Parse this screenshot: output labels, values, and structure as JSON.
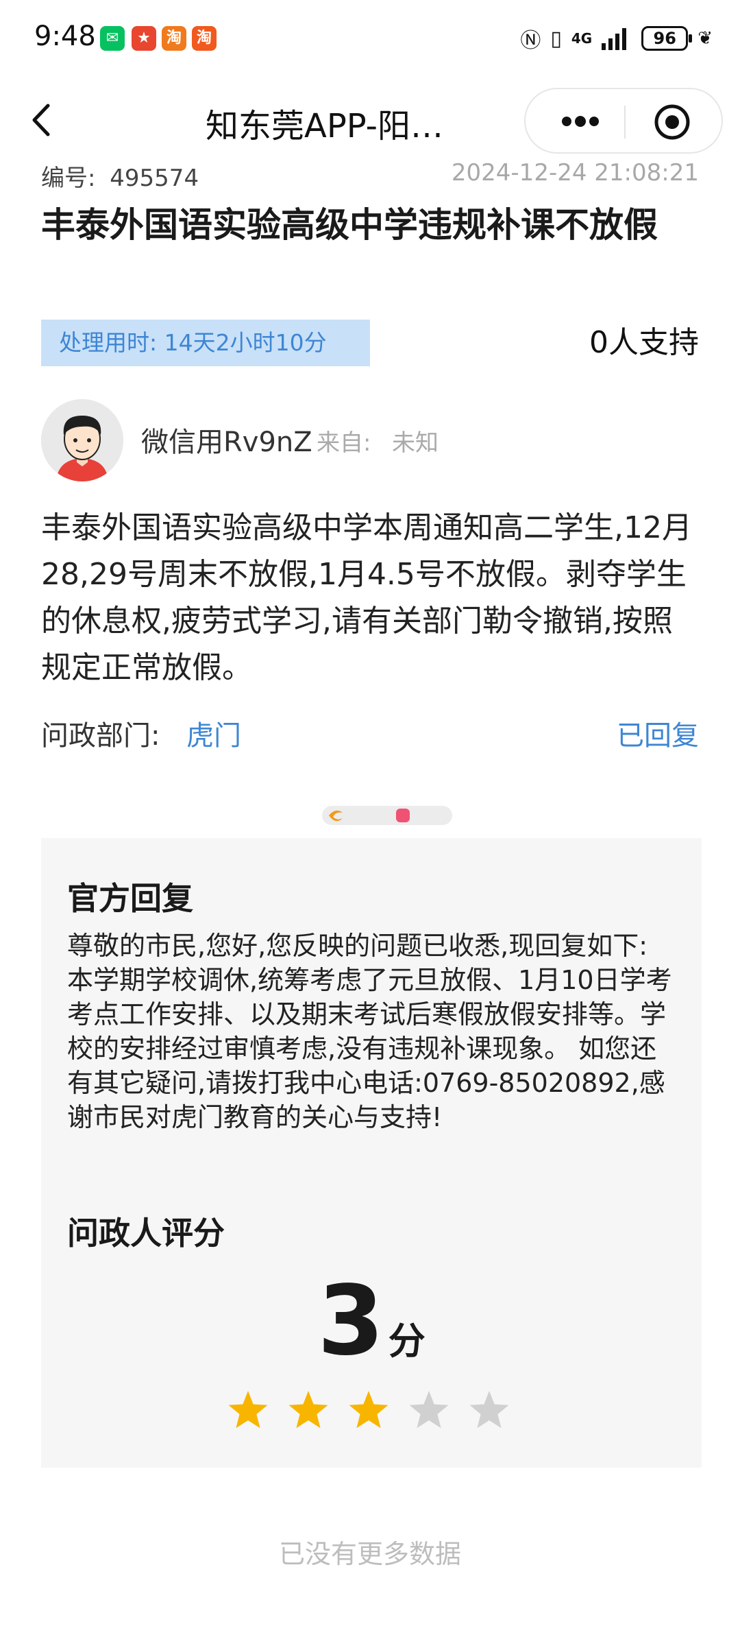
{
  "status_bar": {
    "time": "9:48",
    "network": "4G",
    "battery": "96"
  },
  "nav": {
    "title": "知东莞APP-阳…"
  },
  "post": {
    "id_label": "编号:",
    "id": "495574",
    "datetime": "2024-12-24 21:08:21",
    "title": "丰泰外国语实验高级中学违规补课不放假",
    "duration": "处理用时:  14天2小时10分",
    "support": "0人支持",
    "user": "微信用Rv9nZ",
    "from_label": "来自:",
    "from_value": "未知",
    "body": "丰泰外国语实验高级中学本周通知高二学生,12月28,29号周末不放假,1月4.5号不放假。剥夺学生的休息权,疲劳式学习,请有关部门勒令撤销,按照规定正常放假。",
    "dept_label": "问政部门:",
    "dept": "虎门",
    "status": "已回复"
  },
  "reply": {
    "title": "官方回复",
    "body": "尊敬的市民,您好,您反映的问题已收悉,现回复如下: 本学期学校调休,统筹考虑了元旦放假、1月10日学考考点工作安排、以及期末考试后寒假放假安排等。学校的安排经过审慎考虑,没有违规补课现象。 如您还有其它疑问,请拨打我中心电话:0769-85020892,感谢市民对虎门教育的关心与支持!"
  },
  "rating": {
    "title": "问政人评分",
    "score": "3",
    "unit": "分",
    "stars_filled": 3,
    "stars_total": 5,
    "star_color": "#f7b500",
    "star_empty_color": "#d0d0d0"
  },
  "footer": {
    "no_more": "已没有更多数据"
  },
  "colors": {
    "accent": "#3e86d3",
    "badge_bg": "#c8e0f8",
    "card_bg": "#f6f6f6"
  }
}
